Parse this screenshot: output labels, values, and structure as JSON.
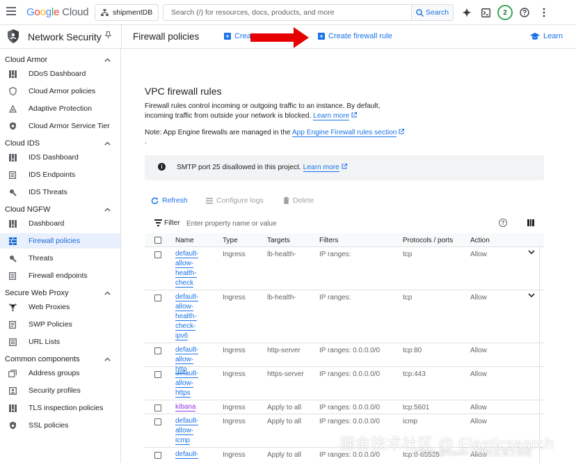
{
  "topbar": {
    "logo_google": "Google",
    "logo_cloud": "Cloud",
    "project": "shipmentDB",
    "search_placeholder": "Search (/) for resources, docs, products, and more",
    "search_button": "Search",
    "notifications_count": "2"
  },
  "header": {
    "product_title": "Network Security",
    "page_title": "Firewall policies",
    "action_create_policy": "Creat",
    "action_create_rule": "Create firewall rule",
    "learn": "Learn"
  },
  "sidebar": {
    "sections": [
      {
        "label": "Cloud Armor",
        "items": [
          {
            "label": "DDoS Dashboard",
            "icon": "dashboard-icon"
          },
          {
            "label": "Cloud Armor policies",
            "icon": "shield-icon"
          },
          {
            "label": "Adaptive Protection",
            "icon": "protection-icon"
          },
          {
            "label": "Cloud Armor Service Tier",
            "icon": "tier-icon"
          }
        ]
      },
      {
        "label": "Cloud IDS",
        "items": [
          {
            "label": "IDS Dashboard",
            "icon": "dashboard-icon"
          },
          {
            "label": "IDS Endpoints",
            "icon": "endpoint-icon"
          },
          {
            "label": "IDS Threats",
            "icon": "threat-icon"
          }
        ]
      },
      {
        "label": "Cloud NGFW",
        "items": [
          {
            "label": "Dashboard",
            "icon": "dashboard-icon"
          },
          {
            "label": "Firewall policies",
            "icon": "firewall-icon"
          },
          {
            "label": "Threats",
            "icon": "threat-icon"
          },
          {
            "label": "Firewall endpoints",
            "icon": "endpoint-icon"
          }
        ]
      },
      {
        "label": "Secure Web Proxy",
        "items": [
          {
            "label": "Web Proxies",
            "icon": "proxy-icon"
          },
          {
            "label": "SWP Policies",
            "icon": "policy-icon"
          },
          {
            "label": "URL Lists",
            "icon": "list-icon"
          }
        ]
      },
      {
        "label": "Common components",
        "items": [
          {
            "label": "Address groups",
            "icon": "address-group-icon"
          },
          {
            "label": "Security profiles",
            "icon": "profile-icon"
          },
          {
            "label": "TLS inspection policies",
            "icon": "tls-icon"
          },
          {
            "label": "SSL policies",
            "icon": "ssl-icon"
          }
        ]
      }
    ]
  },
  "main": {
    "heading": "VPC firewall rules",
    "description": "Firewall rules control incoming or outgoing traffic to an instance. By default, incoming traffic from outside your network is blocked.",
    "learn_more": "Learn more",
    "note_prefix": "Note: App Engine firewalls are managed in the",
    "note_link": "App Engine Firewall rules section",
    "dot": ".",
    "info_text": "SMTP port 25 disallowed in this project.",
    "info_link": "Learn more",
    "toolbar": {
      "refresh": "Refresh",
      "configure_logs": "Configure logs",
      "delete": "Delete"
    },
    "filter_label": "Filter",
    "filter_placeholder": "Enter property name or value",
    "table": {
      "columns": [
        "Name",
        "Type",
        "Targets",
        "Filters",
        "Protocols / ports",
        "Action"
      ],
      "rows": [
        {
          "name_lines": [
            "default-",
            "allow-",
            "health-",
            "check"
          ],
          "type": "Ingress",
          "targets": "lb-health-",
          "filters": "IP ranges:",
          "protocols": "tcp",
          "action": "Allow"
        },
        {
          "name_lines": [
            "default-",
            "allow-",
            "health-",
            "check-",
            "ipv6"
          ],
          "type": "Ingress",
          "targets": "lb-health-",
          "filters": "IP ranges:",
          "protocols": "tcp",
          "action": "Allow"
        },
        {
          "name_lines": [
            "default-",
            "allow-http"
          ],
          "type": "Ingress",
          "targets": "http-server",
          "filters": "IP ranges: 0.0.0.0/0",
          "protocols": "tcp:80",
          "action": "Allow"
        },
        {
          "name_lines": [
            "default-",
            "allow-",
            "https"
          ],
          "type": "Ingress",
          "targets": "https-server",
          "filters": "IP ranges: 0.0.0.0/0",
          "protocols": "tcp:443",
          "action": "Allow"
        },
        {
          "name_lines": [
            "kibana"
          ],
          "type": "Ingress",
          "targets": "Apply to all",
          "filters": "IP ranges: 0.0.0.0/0",
          "protocols": "tcp:5601",
          "action": "Allow"
        },
        {
          "name_lines": [
            "default-",
            "allow-",
            "icmp"
          ],
          "type": "Ingress",
          "targets": "Apply to all",
          "filters": "IP ranges: 0.0.0.0/0",
          "protocols": "icmp",
          "action": "Allow"
        },
        {
          "name_lines": [
            "default-"
          ],
          "type": "Ingress",
          "targets": "Apply to all",
          "filters": "IP ranges: 0.0.0.0/0",
          "protocols": "tcp:0-65535",
          "action": "Allow"
        }
      ]
    }
  },
  "watermark": {
    "main": "掘金技术社区 @ Elasticsearch",
    "sub": "CSDN @Elastic 中国社区官方博客"
  },
  "colors": {
    "accent": "#1a73e8",
    "visited_link": "#9334e6",
    "active_bg": "#e8f0fe",
    "arrow": "#e60000"
  }
}
